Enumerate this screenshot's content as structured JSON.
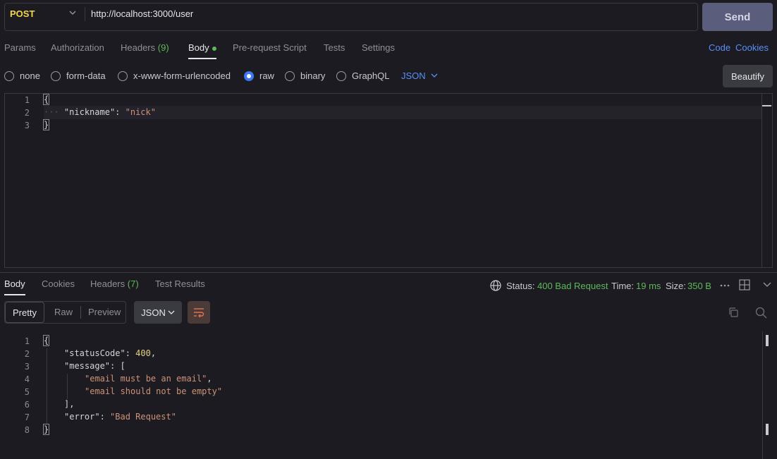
{
  "request": {
    "method": "POST",
    "url": "http://localhost:3000/user",
    "send_label": "Send"
  },
  "request_tabs": {
    "params": "Params",
    "authorization": "Authorization",
    "headers": "Headers",
    "headers_count": "(9)",
    "body": "Body",
    "prerequest": "Pre-request Script",
    "tests": "Tests",
    "settings": "Settings",
    "code_link": "Code",
    "cookies_link": "Cookies"
  },
  "body_types": {
    "none": "none",
    "form_data": "form-data",
    "urlencoded": "x-www-form-urlencoded",
    "raw": "raw",
    "binary": "binary",
    "graphql": "GraphQL",
    "format": "JSON",
    "selected": "raw",
    "beautify": "Beautify"
  },
  "request_body": {
    "line_numbers": [
      "1",
      "2",
      "3"
    ],
    "open": "{",
    "key": "\"nickname\"",
    "colon": ": ",
    "value": "\"nick\"",
    "close": "}"
  },
  "response_tabs": {
    "body": "Body",
    "cookies": "Cookies",
    "headers": "Headers",
    "headers_count": "(7)",
    "test_results": "Test Results"
  },
  "status": {
    "status_label": "Status:",
    "status_value": "400 Bad Request",
    "time_label": "Time:",
    "time_value": "19 ms",
    "size_label": "Size:",
    "size_value": "350 B"
  },
  "response_view": {
    "pretty": "Pretty",
    "raw": "Raw",
    "preview": "Preview",
    "format": "JSON"
  },
  "response_body": {
    "line_numbers": [
      "1",
      "2",
      "3",
      "4",
      "5",
      "6",
      "7",
      "8"
    ],
    "l1": "{",
    "status_key": "\"statusCode\"",
    "status_val": "400",
    "message_key": "\"message\"",
    "msg_open": "[",
    "msg1": "\"email must be an email\"",
    "msg2": "\"email should not be empty\"",
    "msg_close": "],",
    "error_key": "\"error\"",
    "error_val": "\"Bad Request\"",
    "l8": "}"
  },
  "colors": {
    "method": "#f5d54a",
    "accent_link": "#5a8ff7",
    "success_green": "#5fb85a",
    "string": "#ce9178",
    "number": "#e6d28a"
  }
}
